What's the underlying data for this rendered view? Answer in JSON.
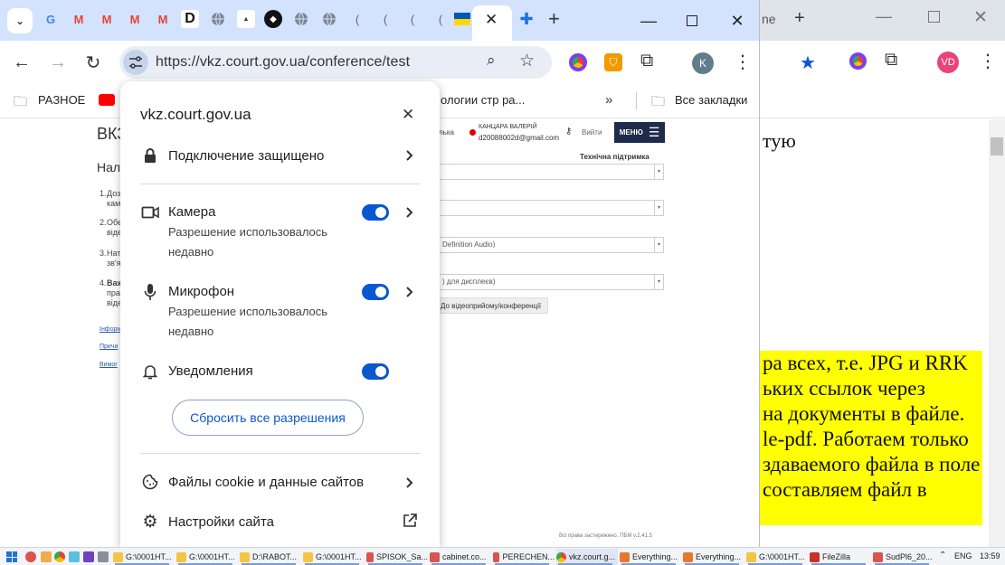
{
  "background_window": {
    "tab_fragment": "ne",
    "doc_top_line": "тую",
    "yellow_lines": [
      "ра всех, т.е. JPG и RRK",
      "ьких ссылок через",
      "на документы в файле.",
      "le-pdf. Работаем только",
      "здаваемого файла в поле",
      "составляем файл в"
    ],
    "profile_initials": "VD"
  },
  "browser": {
    "url": "https://vkz.court.gov.ua/conference/test",
    "profile_initial": "K",
    "bookmarks": {
      "first": "РАЗНОЕ",
      "middle": "ологии стр ра...",
      "all": "Все закладки"
    }
  },
  "page": {
    "title_fragment": "ВКЗ",
    "subtitle_fragment": "Нал",
    "list_items": [
      {
        "num": "1.",
        "lines": [
          "Доз",
          "кам"
        ]
      },
      {
        "num": "2.",
        "lines": [
          "Обе",
          "віде"
        ]
      },
      {
        "num": "3.",
        "lines": [
          "Нат",
          "зв'я"
        ]
      },
      {
        "num": "4.",
        "lines": [
          "Важ",
          "пра",
          "віде"
        ]
      }
    ],
    "links": [
      "Інформ",
      "Причи",
      "Вимог"
    ],
    "header_lang": "лька",
    "user_name": "КАНЦАРА ВАЛЕРІЙ",
    "user_email": "d20088002d@gmail.com",
    "logout": "Вийти",
    "menu": "МЕНЮ",
    "support": "Технічна підтримка",
    "select_audio": "Definition Audio)",
    "select_screen": ") для дисплеєв)",
    "join_button": "До відеоприйому/конференції",
    "footer": "Всі права застережено. ПБМ v.2.41.5"
  },
  "popup": {
    "domain": "vkz.court.gov.ua",
    "secure": "Подключение защищено",
    "camera": {
      "label": "Камера",
      "sub": [
        "Разрешение использовалось",
        "недавно"
      ]
    },
    "microphone": {
      "label": "Микрофон",
      "sub": [
        "Разрешение использовалось",
        "недавно"
      ]
    },
    "notifications": {
      "label": "Уведомления"
    },
    "reset": "Сбросить все разрешения",
    "cookies": "Файлы cookie и данные сайтов",
    "site_settings": "Настройки сайта"
  },
  "taskbar": {
    "items": [
      "G:\\0001HT...",
      "G:\\0001HT...",
      "D:\\RABOT...",
      "G:\\0001HT...",
      "SPISOK_Sa...",
      "cabinet.co...",
      "PERECHEN...",
      "vkz.court.g...",
      "Everything...",
      "Everything...",
      "G:\\0001HT...",
      "FileZilla",
      "SudPl6_20..."
    ],
    "lang": "ENG",
    "time": "13:59"
  },
  "colors": {
    "tabbar": "#d3e3fd",
    "accent": "#0b57d0",
    "highlight": "#ffff00"
  }
}
